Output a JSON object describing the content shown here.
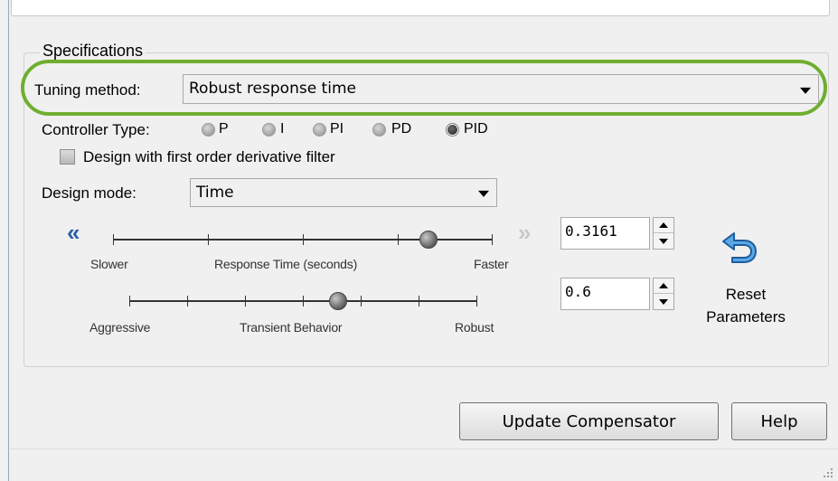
{
  "specifications": {
    "legend": "Specifications",
    "tuning_method_label": "Tuning method:",
    "tuning_method_value": "Robust response time",
    "controller_type_label": "Controller Type:",
    "controller_types": [
      "P",
      "I",
      "PI",
      "PD",
      "PID"
    ],
    "controller_type_selected": "PID",
    "derivative_filter_label": "Design with first order derivative filter",
    "derivative_filter_checked": false,
    "design_mode_label": "Design mode:",
    "design_mode_value": "Time"
  },
  "response_time": {
    "value": "0.3161",
    "slower_label": "Slower",
    "center_label": "Response Time (seconds)",
    "faster_label": "Faster",
    "slider_fraction": 0.83
  },
  "transient": {
    "value": "0.6",
    "left_label": "Aggressive",
    "center_label": "Transient Behavior",
    "right_label": "Robust",
    "slider_fraction": 0.6
  },
  "reset": {
    "line1": "Reset",
    "line2": "Parameters"
  },
  "buttons": {
    "update": "Update Compensator",
    "help": "Help"
  },
  "colors": {
    "highlight": "#6fae2f",
    "chevron": "#2d5fa8"
  },
  "icons": {
    "decrease": "double-chevron-left-icon",
    "increase": "double-chevron-right-icon",
    "reset": "undo-arrow-icon"
  }
}
